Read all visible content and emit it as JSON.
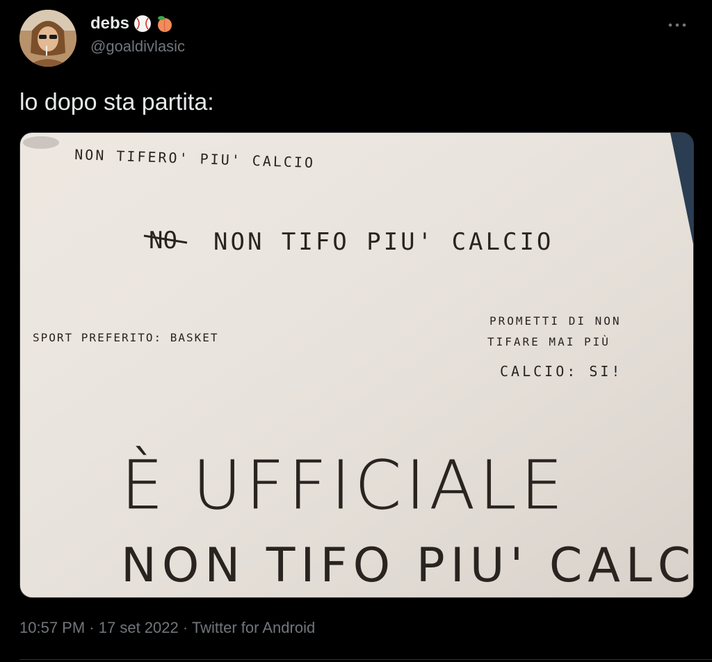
{
  "author": {
    "display_name": "debs",
    "handle": "@goaldivlasic",
    "badges": [
      "baseball-emoji",
      "peach-emoji"
    ]
  },
  "tweet": {
    "text": "lo dopo sta partita:",
    "timestamp": "10:57 PM",
    "date": "17 set 2022",
    "separator": "·",
    "source": "Twitter for Android"
  },
  "media": {
    "lines": {
      "line1": "NON TIFERO' PIU' CALCIO",
      "line2_struck": "NO",
      "line2": "NON TIFO PIU' CALCIO",
      "sport_label": "SPORT PREFERITO: BASKET",
      "promise_1": "PROMETTI DI NON",
      "promise_2": "TIFARE MAI PIÙ",
      "promise_3": "CALCIO: SI!",
      "big_1": "È UFFICIALE",
      "big_2": "NON TIFO PIU' CALCIO"
    }
  },
  "colors": {
    "background": "#000000",
    "text": "#e7e9ea",
    "muted": "#71767b",
    "paper": "#ece6df",
    "ink": "#2a2420"
  }
}
